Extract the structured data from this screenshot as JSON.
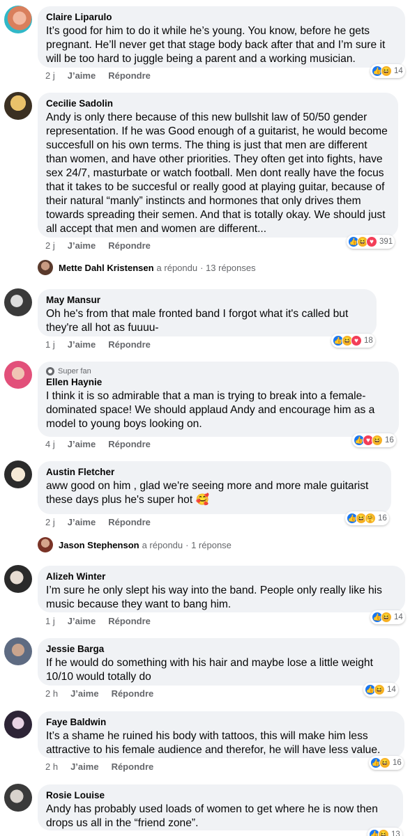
{
  "labels": {
    "like": "J’aime",
    "reply": "Répondre"
  },
  "comments": [
    {
      "author": "Claire Liparulo",
      "text": "It’s good for him to do it while he’s young. You know, before he gets pregnant. He’ll never get that stage body back after that and I’m sure it will be too hard to juggle being a parent and a working musician.",
      "time": "2 j",
      "reactions": [
        "like",
        "haha"
      ],
      "count": "14"
    },
    {
      "author": "Cecilie Sadolin",
      "text": "Andy is only there because of this new bullshit law of 50/50 gender representation. If he was Good enough of a guitarist, he would become succesfull on his own terms. The thing is just that men are different than women, and have other priorities. They often get into fights, have sex 24/7, masturbate or watch football. Men dont really have the focus that it takes to be succesful or really good at playing guitar, because of their natural “manly” instincts and hormones that only drives them towards spreading their semen. And that is totally okay. We should just all accept that men and women are different...",
      "time": "2 j",
      "reactions": [
        "like",
        "haha",
        "love"
      ],
      "count": "391"
    },
    {
      "author": "May Mansur",
      "text": "Oh he's from that male fronted band I forgot what it's called but they're all hot as fuuuu-",
      "time": "1 j",
      "reactions": [
        "like",
        "haha",
        "love"
      ],
      "count": "18"
    },
    {
      "badge": "Super fan",
      "author": "Ellen Haynie",
      "text": "I think it is so admirable that a man is trying to break into a female-dominated space! We should applaud Andy and encourage him as a model to young boys looking on.",
      "time": "4 j",
      "reactions": [
        "like",
        "love",
        "haha"
      ],
      "count": "16"
    },
    {
      "author": "Austin Fletcher",
      "text": "aww good on him , glad we're seeing more and more male guitarist these days plus he's super hot 🥰",
      "time": "2 j",
      "reactions": [
        "like",
        "haha",
        "care"
      ],
      "count": "16"
    },
    {
      "author": "Alizeh Winter",
      "text": "I’m sure he only slept his way into the band. People only really like his music because they want to bang him.",
      "time": "1 j",
      "reactions": [
        "like",
        "haha"
      ],
      "count": "14"
    },
    {
      "author": "Jessie Barga",
      "text": "If he would do something with his hair and maybe lose a little weight 10/10 would totally do",
      "time": "2 h",
      "reactions": [
        "like",
        "haha"
      ],
      "count": "14"
    },
    {
      "author": "Faye Baldwin",
      "text": "It’s a shame he ruined his body with tattoos, this will make him less attractive to his female audience and therefor, he will have less value.",
      "time": "2 h",
      "reactions": [
        "like",
        "haha"
      ],
      "count": "16"
    },
    {
      "author": "Rosie Louise",
      "text": "Andy has probably used loads of women to get where he is now then drops us all in the “friend zone”.",
      "time": "",
      "reactions": [
        "like",
        "haha"
      ],
      "count": "13"
    }
  ],
  "replies": [
    {
      "name": "Mette Dahl Kristensen",
      "action": "a répondu",
      "count": "· 13 réponses"
    },
    {
      "name": "Jason Stephenson",
      "action": "a répondu",
      "count": "· 1 réponse"
    }
  ],
  "colors": {
    "bubble": "#f0f2f5",
    "meta": "#65676b",
    "like": "#1877f2",
    "haha": "#f7b125",
    "love": "#f33e58"
  }
}
